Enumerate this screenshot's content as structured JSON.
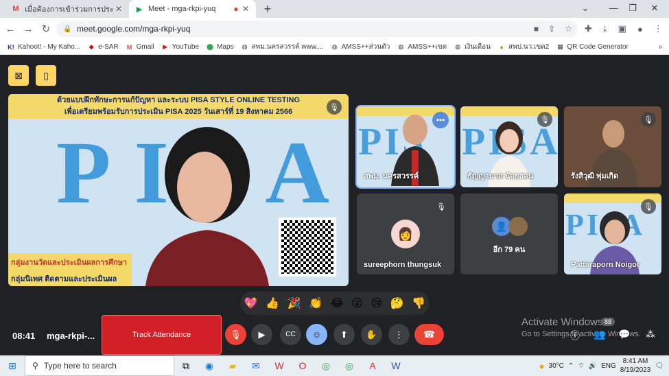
{
  "browser": {
    "tabs": [
      {
        "title": "เมื่อต้องการเข้าร่วมการประชุมทางวิดีโอ",
        "favicon": "gmail-icon"
      },
      {
        "title": "Meet - mga-rkpi-yuq",
        "favicon": "meet-icon"
      }
    ],
    "new_tab": "+",
    "url": "meet.google.com/mga-rkpi-yuq",
    "bookmarks": [
      "Kahoot! - My Kaho...",
      "e-SAR",
      "Gmail",
      "YouTube",
      "Maps",
      "สพม.นครสวรรค์ www....",
      "AMSS++ส่วนตัว",
      "AMSS++เขต",
      "เงินเดือน",
      "สพป.นว.เขต2",
      "QR Code Generator"
    ]
  },
  "meet": {
    "main_tile": {
      "banner_line1": "ด้วยแบบฝึกทักษะการแก้ปัญหา และระบบ PISA STYLE ONLINE TESTING",
      "banner_line2": "เพื่อเตรียมพร้อมรับการประเมิน PISA 2025 วันเสาร์ที่ 19 สิงหาคม 2566",
      "logo_text": "PISA",
      "lower_text1": "กลุ่มงานวัดและประเมินผลการศึกษา",
      "lower_text2": "กลุ่มนิเทศ ติดตามและประเมินผล"
    },
    "tiles": [
      {
        "name": "สพม. นครสวรรค์"
      },
      {
        "name": "ธัญญามาส น้อยสอน"
      },
      {
        "name": "รังสิวุฒิ พุ่มเกิด"
      },
      {
        "name": "sureephorn thungsuk"
      },
      {
        "name": "อีก 79 คน"
      },
      {
        "name": "Pattaraporn Noigor"
      }
    ],
    "reactions": [
      "💖",
      "👍",
      "🎉",
      "👏",
      "😂",
      "😮",
      "😢",
      "🤔",
      "👎"
    ],
    "bottom": {
      "time": "08:41",
      "meeting_code": "mga-rkpi-...",
      "track_attendance": "Track Attendance",
      "activate_title": "Activate Windows",
      "activate_sub": "Go to Settings to activate Windows.",
      "people_count": "88"
    }
  },
  "taskbar": {
    "search_placeholder": "Type here to search",
    "weather": "30°C",
    "lang": "ENG",
    "time": "8:41 AM",
    "date": "8/19/2023"
  }
}
